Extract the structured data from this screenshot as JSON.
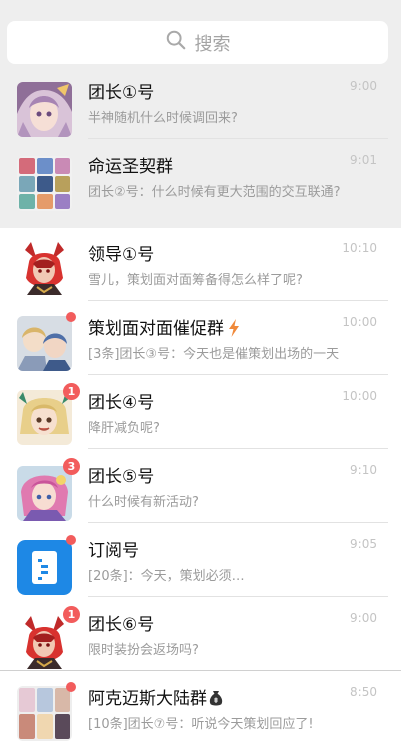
{
  "search": {
    "placeholder": "搜索",
    "icon": "search-icon"
  },
  "colors": {
    "pinned_bg": "#eeeeee",
    "badge": "#f25c5c",
    "subscription_blue": "#1e88e5",
    "bolt": "#f0893a"
  },
  "conversations": [
    {
      "title": "团长①号",
      "time": "9:00",
      "preview": "半神随机什么时候调回来?",
      "pinned": true,
      "avatar": "avatar-anime-girl"
    },
    {
      "title": "命运圣契群",
      "time": "9:01",
      "preview": "团长②号：什么时候有更大范围的交互联通?",
      "pinned": true,
      "avatar": "avatar-group-grid"
    },
    {
      "title": "领导①号",
      "time": "10:10",
      "preview": "雪儿，策划面对面筹备得怎么样了呢?",
      "avatar": "avatar-red-demon"
    },
    {
      "title": "策划面对面催促群",
      "time": "10:00",
      "preview": "[3条]团长③号：今天也是催策划出场的一天",
      "badge_dot": true,
      "title_icon": "lightning-icon",
      "avatar": "avatar-group-pair"
    },
    {
      "title": "团长④号",
      "time": "10:00",
      "preview": "降肝减负呢?",
      "badge": "1",
      "avatar": "avatar-blonde-girl"
    },
    {
      "title": "团长⑤号",
      "time": "9:10",
      "preview": "什么时候有新活动?",
      "badge": "3",
      "avatar": "avatar-pink-hair"
    },
    {
      "title": "订阅号",
      "time": "9:05",
      "preview": "[20条]：今天，策划必须…",
      "badge_dot": true,
      "avatar": "subscription-icon"
    },
    {
      "title": "团长⑥号",
      "time": "9:00",
      "preview": "限时装扮会返场吗?",
      "badge": "1",
      "avatar": "avatar-red-demon"
    },
    {
      "title": "阿克迈斯大陆群",
      "time": "8:50",
      "preview": "[10条]团长⑦号：听说今天策划回应了!",
      "badge_dot": true,
      "title_icon": "money-bag-icon",
      "avatar": "avatar-group-grid-2"
    }
  ]
}
